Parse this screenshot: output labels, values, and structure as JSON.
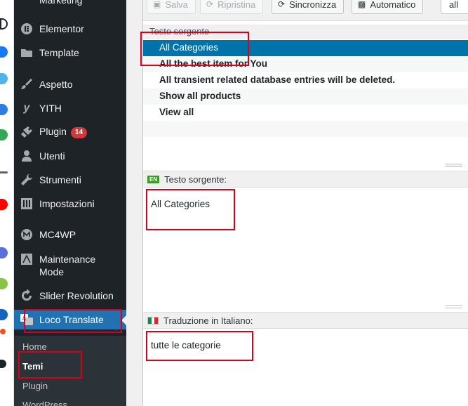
{
  "sidebar": {
    "top_partial": "Marketing",
    "items": [
      {
        "label": "Elementor",
        "icon": "elementor-icon"
      },
      {
        "label": "Template",
        "icon": "folder-icon"
      },
      {
        "label": "Aspetto",
        "icon": "paintbrush-icon"
      },
      {
        "label": "YITH",
        "icon": "yith-icon"
      },
      {
        "label": "Plugin",
        "icon": "plugin-icon",
        "badge": "14"
      },
      {
        "label": "Utenti",
        "icon": "user-icon"
      },
      {
        "label": "Strumenti",
        "icon": "wrench-icon"
      },
      {
        "label": "Impostazioni",
        "icon": "settings-icon"
      },
      {
        "label": "MC4WP",
        "icon": "mc4wp-icon"
      },
      {
        "label": "Maintenance Mode",
        "icon": "maintenance-icon"
      },
      {
        "label": "Slider Revolution",
        "icon": "refresh-icon"
      },
      {
        "label": "Loco Translate",
        "icon": "translate-icon",
        "current": true
      }
    ],
    "submenu": [
      "Home",
      "Temi",
      "Plugin",
      "WordPress"
    ]
  },
  "toolbar": {
    "save_label": "Salva",
    "restore_label": "Ripristina",
    "sync_label": "Sincronizza",
    "auto_label": "Automatico",
    "filter_value": "all"
  },
  "list": {
    "header": "Testo sorgente",
    "rows": [
      "All Categories",
      "All the best item for You",
      "All transient related database entries will be deleted.",
      "Show all products",
      "View all"
    ]
  },
  "source_pane": {
    "lang_code": "EN",
    "title": "Testo sorgente:",
    "text": "All Categories"
  },
  "translation_pane": {
    "title": "Traduzione in Italiano:",
    "text": "tutte le categorie"
  },
  "colors": {
    "sidebar_bg": "#1d2327",
    "accent": "#2271b1",
    "selected_row": "#0073aa",
    "badge": "#d63638",
    "annotation": "#d9001b"
  }
}
